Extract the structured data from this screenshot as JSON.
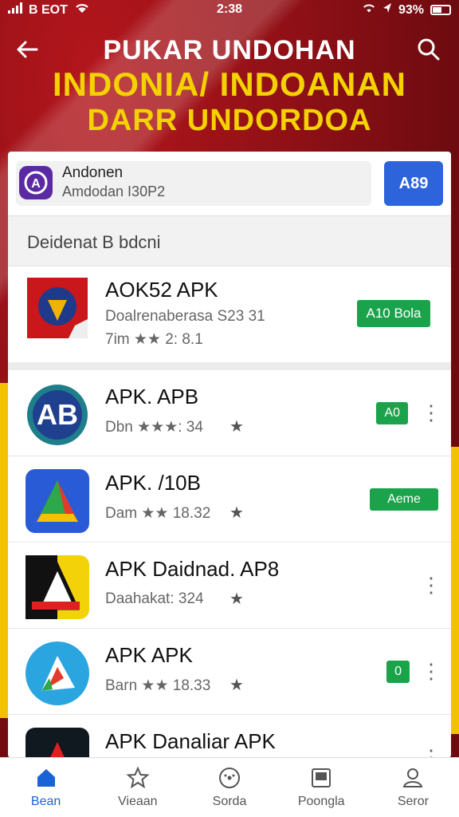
{
  "status_bar": {
    "carrier": "B EOT",
    "time": "2:38",
    "battery": "93%"
  },
  "header": {
    "title_line1": "PUKAR UNDOHAN",
    "title_line2": "INDONIA/ INDOANAN",
    "title_line3": "DARR UNDORDOA"
  },
  "top_app": {
    "name": "Andonen",
    "subtitle": "Amdodan I30P2",
    "button_label": "A89"
  },
  "section": {
    "title": "Deidenat B bdcni"
  },
  "featured": {
    "name": "AOK52 APK",
    "subtitle": "Doalrenaberasa S23 31",
    "meta": "7im ★★ 2: 8.1",
    "button_label": "A10 Bola"
  },
  "apps": [
    {
      "name": "APK. APB",
      "subtitle": "Dbn ★★★: 34",
      "button_label": "A0",
      "has_more": true
    },
    {
      "name": "APK. /10B",
      "subtitle": "Dam ★★ 18.32",
      "button_label": "Aeme",
      "has_more": false
    },
    {
      "name": "APK Daidnad. AP8",
      "subtitle": "Daahakat: 324",
      "button_label": "",
      "has_more": true
    },
    {
      "name": "APK APK",
      "subtitle": "Barn ★★ 18.33",
      "button_label": "0",
      "has_more": true
    },
    {
      "name": "APK Danaliar APK",
      "subtitle": "",
      "button_label": "",
      "has_more": true
    }
  ],
  "nav": [
    {
      "label": "Bean",
      "icon": "home-icon",
      "active": true
    },
    {
      "label": "Vieaan",
      "icon": "star-icon",
      "active": false
    },
    {
      "label": "Sorda",
      "icon": "compass-icon",
      "active": false
    },
    {
      "label": "Poongla",
      "icon": "tablet-icon",
      "active": false
    },
    {
      "label": "Seror",
      "icon": "person-icon",
      "active": false
    }
  ]
}
